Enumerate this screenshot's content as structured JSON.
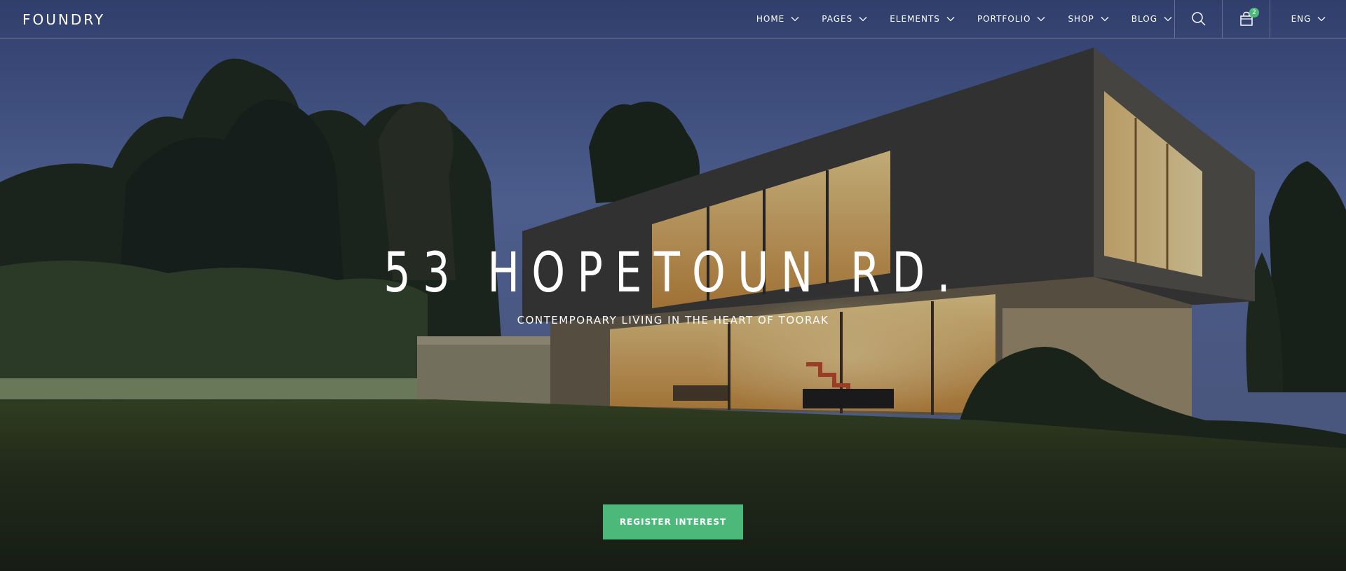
{
  "brand": {
    "logo": "FOUNDRY"
  },
  "nav": {
    "items": [
      {
        "label": "HOME"
      },
      {
        "label": "PAGES"
      },
      {
        "label": "ELEMENTS"
      },
      {
        "label": "PORTFOLIO"
      },
      {
        "label": "SHOP"
      },
      {
        "label": "BLOG"
      }
    ],
    "cart_count": "2",
    "language": "ENG"
  },
  "hero": {
    "title": "53 HOPETOUN RD.",
    "subtitle": "CONTEMPORARY LIVING IN THE HEART OF TOORAK",
    "cta_label": "REGISTER INTEREST"
  },
  "colors": {
    "accent": "#4cb87a",
    "sky_top": "#3c4f86",
    "sky_mid": "#6275ad",
    "lawn": "#1e2616"
  },
  "icons": {
    "search": "search-icon",
    "cart": "shopping-bag-icon",
    "dropdown": "chevron-down-icon"
  }
}
